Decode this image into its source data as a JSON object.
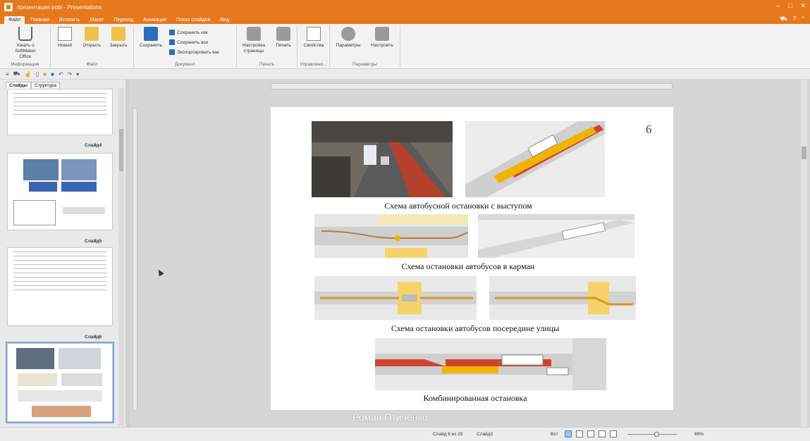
{
  "window": {
    "title": "презентация pobi - Presentations"
  },
  "menu": {
    "tabs": [
      "Файл",
      "Главная",
      "Вставить",
      "Макет",
      "Переход",
      "Анимация",
      "Показ слайдов",
      "Вид"
    ]
  },
  "ribbon": {
    "info": {
      "button": "Узнать о SoftMaker Office",
      "label": "Информация"
    },
    "file": {
      "new": "Новый",
      "open": "Открыть",
      "close": "Закрыть",
      "save": "Сохранить",
      "label": "Файл"
    },
    "document": {
      "save_as": "Сохранить как",
      "save_all": "Сохранить все",
      "export_as": "Экспортировать как",
      "label": "Документ"
    },
    "print": {
      "page_setup": "Настройка страницы",
      "print": "Печать",
      "label": "Печать"
    },
    "manage": {
      "properties": "Свойства",
      "label": "Управлени..."
    },
    "params": {
      "options": "Параметры",
      "customize": "Настроить",
      "label": "Параметры"
    }
  },
  "pane": {
    "tabs": [
      "Слайды",
      "Структура"
    ],
    "slides": [
      {
        "label": "Слайд4"
      },
      {
        "label": "Слайд5"
      },
      {
        "label": "Слайд6"
      }
    ]
  },
  "slide": {
    "number": "6",
    "captions": [
      "Схема автобусной остановки с выступом",
      "Схема остановки автобусов в карман",
      "Схема остановки автобусов посередине улицы",
      "Комбинированная остановка"
    ]
  },
  "watermark": "Роман Птиченко",
  "status": {
    "slide_of": "Слайд 6 из 25",
    "slide_name": "Слайд3",
    "all": "Вст",
    "zoom": "89%"
  },
  "colors": {
    "accent": "#e6791c",
    "selection": "#79a8dd"
  }
}
